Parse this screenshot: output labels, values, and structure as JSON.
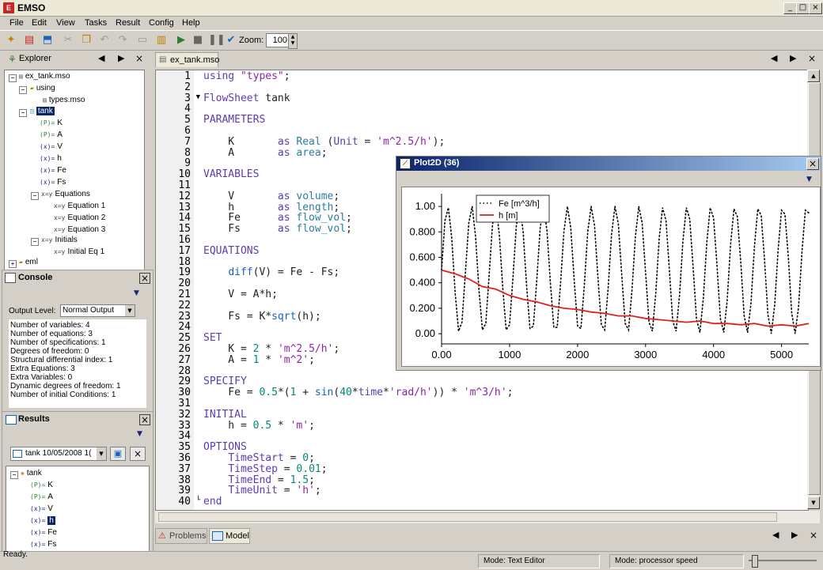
{
  "window": {
    "title": "EMSO",
    "icon": "emso-app-icon"
  },
  "menu": [
    "File",
    "Edit",
    "View",
    "Tasks",
    "Result",
    "Config",
    "Help"
  ],
  "toolbar": {
    "zoom_label": "Zoom:",
    "zoom_value": "100"
  },
  "explorer": {
    "tab_label": "Explorer",
    "tree": [
      {
        "label": "ex_tank.mso",
        "icon": "file-icon"
      },
      {
        "label": "using",
        "icon": "folder-icon"
      },
      {
        "label": "types.mso",
        "icon": "file-icon"
      },
      {
        "label": "tank",
        "icon": "flowsheet-icon",
        "selected": true
      },
      {
        "label": "K",
        "icon": "parameter-icon",
        "badge": "(P)="
      },
      {
        "label": "A",
        "icon": "parameter-icon",
        "badge": "(P)="
      },
      {
        "label": "V",
        "icon": "variable-icon",
        "badge": "(x)="
      },
      {
        "label": "h",
        "icon": "variable-icon",
        "badge": "(x)="
      },
      {
        "label": "Fe",
        "icon": "variable-icon",
        "badge": "(x)="
      },
      {
        "label": "Fs",
        "icon": "variable-icon",
        "badge": "(x)="
      },
      {
        "label": "Equations",
        "icon": "equations-icon",
        "badge": "x=y"
      },
      {
        "label": "Equation 1",
        "icon": "equation-icon",
        "badge": "x=y"
      },
      {
        "label": "Equation 2",
        "icon": "equation-icon",
        "badge": "x=y"
      },
      {
        "label": "Equation 3",
        "icon": "equation-icon",
        "badge": "x=y"
      },
      {
        "label": "Initials",
        "icon": "initials-icon",
        "badge": "x=y"
      },
      {
        "label": "Initial Eq 1",
        "icon": "equation-icon",
        "badge": "x=y"
      },
      {
        "label": "eml",
        "icon": "folder-icon"
      }
    ]
  },
  "console": {
    "title": "Console",
    "output_level_label": "Output Level:",
    "output_level_value": "Normal Output",
    "lines": [
      "Number of variables: 4",
      "Number of equations: 3",
      "Number of specifications: 1",
      "Degrees of freedom: 0",
      "Structural differential index: 1",
      "Extra Equations:    3",
      "Extra Variables:    0",
      "Dynamic degrees of freedom:  1",
      "Number of initial Conditions: 1"
    ]
  },
  "results": {
    "title": "Results",
    "selected_run": "tank  10/05/2008 1(",
    "tree": [
      {
        "label": "tank",
        "badge": ""
      },
      {
        "label": "K",
        "badge": "(P)="
      },
      {
        "label": "A",
        "badge": "(P)="
      },
      {
        "label": "V",
        "badge": "(x)="
      },
      {
        "label": "h",
        "badge": "(x)=",
        "selected": true
      },
      {
        "label": "Fe",
        "badge": "(x)="
      },
      {
        "label": "Fs",
        "badge": "(x)="
      }
    ]
  },
  "editor": {
    "tab_label": "ex_tank.mso",
    "lines": [
      "using \"types\";",
      "",
      "FlowSheet tank",
      "",
      "PARAMETERS",
      "",
      "    K       as Real (Unit = 'm^2.5/h');",
      "    A       as area;",
      "",
      "VARIABLES",
      "",
      "    V       as volume;",
      "    h       as length;",
      "    Fe      as flow_vol;",
      "    Fs      as flow_vol;",
      "",
      "EQUATIONS",
      "",
      "    diff(V) = Fe - Fs;",
      "",
      "    V = A*h;",
      "",
      "    Fs = K*sqrt(h);",
      "",
      "SET",
      "    K = 2 * 'm^2.5/h';",
      "    A = 1 * 'm^2';",
      "",
      "SPECIFY",
      "    Fe = 0.5*(1 + sin(40*time*'rad/h')) * 'm^3/h';",
      "",
      "INITIAL",
      "    h = 0.5 * 'm';",
      "",
      "OPTIONS",
      "    TimeStart = 0;",
      "    TimeStep = 0.01;",
      "    TimeEnd = 1.5;",
      "    TimeUnit = 'h';",
      "end"
    ]
  },
  "plot": {
    "title": "Plot2D (36)"
  },
  "chart_data": {
    "type": "line",
    "xlim": [
      0,
      5400
    ],
    "ylim": [
      -0.08,
      1.1
    ],
    "xticks": [
      "0.00",
      "1000",
      "2000",
      "3000",
      "4000",
      "5000"
    ],
    "xtick_values": [
      0,
      1000,
      2000,
      3000,
      4000,
      5000
    ],
    "yticks": [
      "0.00",
      "0.200",
      "0.400",
      "0.600",
      "0.800",
      "1.00"
    ],
    "ytick_values": [
      0,
      0.2,
      0.4,
      0.6,
      0.8,
      1.0
    ],
    "legend_position": "top-left",
    "series": [
      {
        "name": "Fe [m^3/h]",
        "style": "dotted",
        "color": "#000000",
        "x": [
          0,
          50,
          100,
          150,
          200,
          250,
          300,
          350,
          400,
          450,
          500,
          550,
          600,
          650,
          700,
          750,
          800,
          850,
          900,
          950,
          1000,
          1050,
          1100,
          1150,
          1200,
          1250,
          1300,
          1350,
          1400,
          1450,
          1500,
          1550,
          1600,
          1650,
          1700,
          1750,
          1800,
          1850,
          1900,
          1950,
          2000,
          2050,
          2100,
          2150,
          2200,
          2250,
          2300,
          2350,
          2400,
          2450,
          2500,
          2550,
          2600,
          2650,
          2700,
          2750,
          2800,
          2850,
          2900,
          2950,
          3000,
          3050,
          3100,
          3150,
          3200,
          3250,
          3300,
          3350,
          3400,
          3450,
          3500,
          3550,
          3600,
          3650,
          3700,
          3750,
          3800,
          3850,
          3900,
          3950,
          4000,
          4050,
          4100,
          4150,
          4200,
          4250,
          4300,
          4350,
          4400,
          4450,
          4500,
          4550,
          4600,
          4650,
          4700,
          4750,
          4800,
          4850,
          4900,
          4950,
          5000,
          5050,
          5100,
          5150,
          5200,
          5250,
          5300,
          5350,
          5400
        ],
        "y": [
          0.5,
          0.89,
          0.99,
          0.75,
          0.32,
          0.02,
          0.09,
          0.48,
          0.87,
          1.0,
          0.76,
          0.34,
          0.03,
          0.08,
          0.46,
          0.86,
          1.0,
          0.78,
          0.36,
          0.03,
          0.07,
          0.44,
          0.85,
          1.0,
          0.8,
          0.38,
          0.04,
          0.06,
          0.42,
          0.83,
          1.0,
          0.81,
          0.4,
          0.05,
          0.05,
          0.4,
          0.81,
          1.0,
          0.83,
          0.42,
          0.06,
          0.04,
          0.38,
          0.8,
          1.0,
          0.85,
          0.44,
          0.07,
          0.03,
          0.36,
          0.78,
          1.0,
          0.86,
          0.46,
          0.08,
          0.03,
          0.34,
          0.76,
          1.0,
          0.87,
          0.48,
          0.09,
          0.02,
          0.32,
          0.75,
          0.99,
          0.89,
          0.5,
          0.1,
          0.02,
          0.3,
          0.73,
          0.99,
          0.9,
          0.52,
          0.11,
          0.01,
          0.28,
          0.71,
          0.99,
          0.91,
          0.54,
          0.12,
          0.01,
          0.26,
          0.7,
          0.98,
          0.92,
          0.56,
          0.14,
          0.01,
          0.24,
          0.68,
          0.98,
          0.93,
          0.58,
          0.15,
          0.0,
          0.23,
          0.66,
          0.97,
          0.94,
          0.6,
          0.16,
          0.0,
          0.21,
          0.64,
          0.97,
          0.95
        ]
      },
      {
        "name": "h [m]",
        "style": "solid",
        "color": "#e02020",
        "x": [
          0,
          200,
          400,
          600,
          800,
          1000,
          1200,
          1400,
          1600,
          1800,
          2000,
          2200,
          2400,
          2600,
          2800,
          3000,
          3200,
          3400,
          3600,
          3800,
          4000,
          4200,
          4400,
          4600,
          4800,
          5000,
          5200,
          5400
        ],
        "y": [
          0.5,
          0.47,
          0.43,
          0.37,
          0.35,
          0.3,
          0.27,
          0.25,
          0.22,
          0.2,
          0.19,
          0.17,
          0.16,
          0.14,
          0.14,
          0.12,
          0.11,
          0.1,
          0.09,
          0.1,
          0.08,
          0.08,
          0.07,
          0.08,
          0.06,
          0.07,
          0.06,
          0.08
        ]
      }
    ]
  },
  "bottom_tabs": [
    "Problems",
    "Model"
  ],
  "status": {
    "left": "Ready.",
    "mode1": "Mode: Text Editor",
    "mode2": "Mode: processor speed"
  }
}
